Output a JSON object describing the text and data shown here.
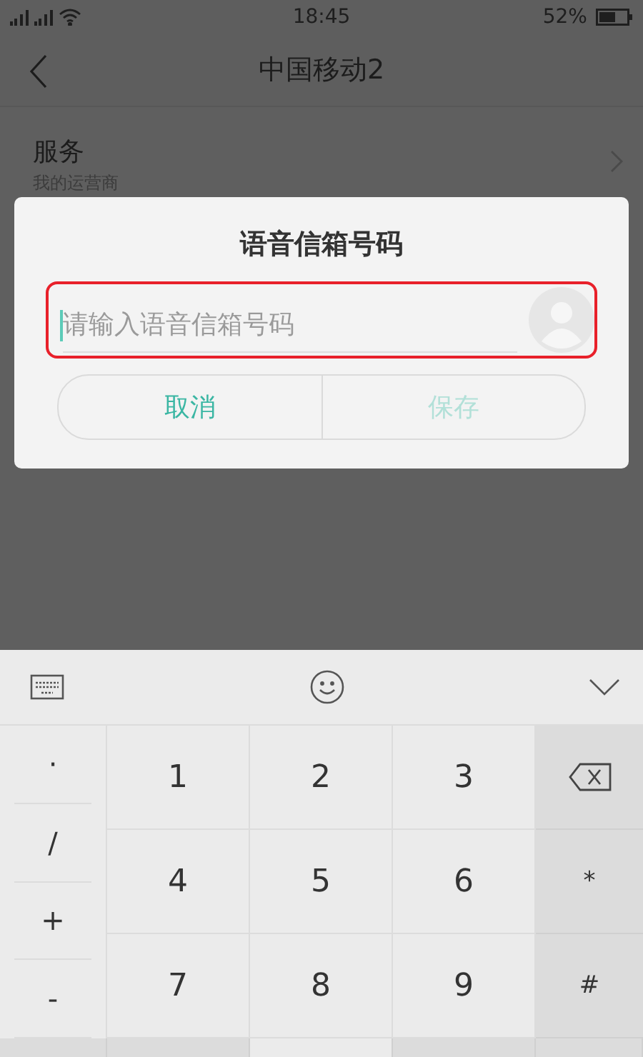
{
  "status_bar": {
    "time": "18:45",
    "battery": "52%"
  },
  "header": {
    "title": "中国移动2"
  },
  "settings": [
    {
      "title": "服务",
      "subtitle": "我的运营商"
    }
  ],
  "dialog": {
    "title": "语音信箱号码",
    "field": {
      "placeholder": "请输入语音信箱号码"
    },
    "buttons": [
      {
        "label": "取消",
        "disabled": false
      },
      {
        "label": "保存",
        "disabled": true
      }
    ]
  },
  "keyboard": {
    "side_keys": [
      "·",
      "/",
      "+",
      "-"
    ],
    "keys": [
      {
        "label": "1",
        "kind": "digit"
      },
      {
        "label": "2",
        "kind": "digit"
      },
      {
        "label": "3",
        "kind": "digit"
      },
      {
        "kind": "backspace"
      },
      {
        "label": "4",
        "kind": "digit"
      },
      {
        "label": "5",
        "kind": "digit"
      },
      {
        "label": "6",
        "kind": "digit"
      },
      {
        "label": "*",
        "kind": "symbol"
      },
      {
        "label": "7",
        "kind": "digit"
      },
      {
        "label": "8",
        "kind": "digit"
      },
      {
        "label": "9",
        "kind": "digit"
      },
      {
        "label": "#",
        "kind": "symbol"
      }
    ]
  }
}
